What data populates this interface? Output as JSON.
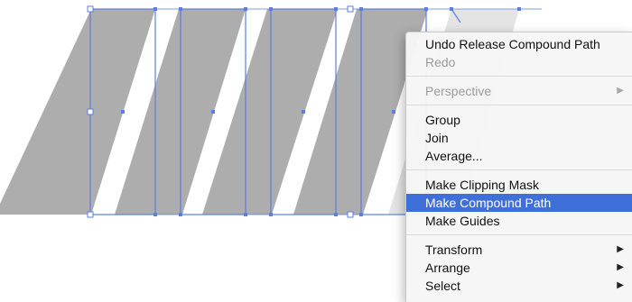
{
  "context_menu": {
    "items": [
      {
        "label": "Undo Release Compound Path",
        "enabled": true
      },
      {
        "label": "Redo",
        "enabled": false
      },
      {
        "separator": true
      },
      {
        "label": "Perspective",
        "enabled": false,
        "submenu": true,
        "arrow_icon": "submenu-arrow-icon"
      },
      {
        "separator": true
      },
      {
        "label": "Group",
        "enabled": true
      },
      {
        "label": "Join",
        "enabled": true
      },
      {
        "label": "Average...",
        "enabled": true
      },
      {
        "separator": true
      },
      {
        "label": "Make Clipping Mask",
        "enabled": true
      },
      {
        "label": "Make Compound Path",
        "enabled": true,
        "highlighted": true
      },
      {
        "label": "Make Guides",
        "enabled": true
      },
      {
        "separator": true
      },
      {
        "label": "Transform",
        "enabled": true,
        "submenu": true,
        "arrow_icon": "submenu-arrow-icon"
      },
      {
        "label": "Arrange",
        "enabled": true,
        "submenu": true,
        "arrow_icon": "submenu-arrow-icon"
      },
      {
        "label": "Select",
        "enabled": true,
        "submenu": true,
        "arrow_icon": "submenu-arrow-icon"
      }
    ],
    "submenu_arrow": "▶",
    "highlight_color": "#3f6fd8"
  },
  "canvas": {
    "shape_color": "#adadad",
    "selection_color": "#5b7fe0",
    "selected_objects": 5
  }
}
